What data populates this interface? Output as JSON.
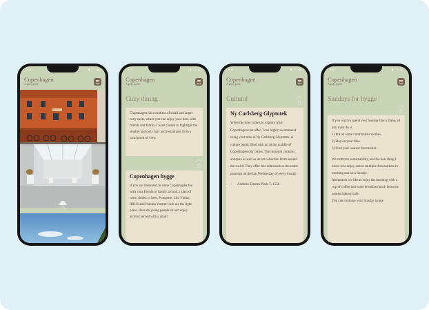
{
  "status": {
    "time": "9:41",
    "icons": "▮ ◠ ▬"
  },
  "app": {
    "title": "Copenhagen",
    "subtitle": "A girly guide"
  },
  "screen2": {
    "section_title": "Cozy dining",
    "intro": "Copenhagen has countless of small and larger cozy spots, where you can enjoy your time with friends and family. I have chosen to highlight the smaller and cozy bars and restaurants from a local point of view.",
    "card_title": "Copenhagen hygge",
    "card_text": "If you are interested in some Copenhagen fun with your friends or family around a glass of wine, drinks or beer, Pompette, Lilo Vinbar, BRUS and Paloma Vermut Cafe are the right place. Here do young people sit and enjoy alcohol served with a small"
  },
  "screen3": {
    "section_title": "Cultural",
    "card_title": "Ny Carlsberg Glyptotek",
    "card_text": "When the time comes to explore what Copenhagen can offer, I can highly recommend using your time at Ny Carlsberg Glyptotek. A culture bomb filled with art in the middle of Copenhagen city center. The museum contains antiques as well as an art collection from around the world. They offer free admission to the entire museum on the last Wednesday of every month.",
    "address": "Address: Dantes Plads 7, 1556"
  },
  "screen4": {
    "section_title": "Sundays for hygge",
    "lines": [
      "If you want to spend your Sunday like a Dane, all you must do is:",
      "1) Put on some comfortable clothes.",
      "2) Hop on your bike.",
      "3) Find your nearest flea market.",
      "",
      "We cultivate sustainability, and the best thing I know is to enjoy one or multiple flea markets in morning sun on a Sunday.",
      "Afterwards we like to enjoy the morning with a cup of coffee and some breakfast/lunch from the nearest bakery/cafe.",
      "You can continue your Sunday hygge"
    ]
  },
  "colors": {
    "background": "#dff0f6",
    "screen": "#c9d3b6",
    "card": "#ece2d0",
    "accent": "#7a6757"
  }
}
